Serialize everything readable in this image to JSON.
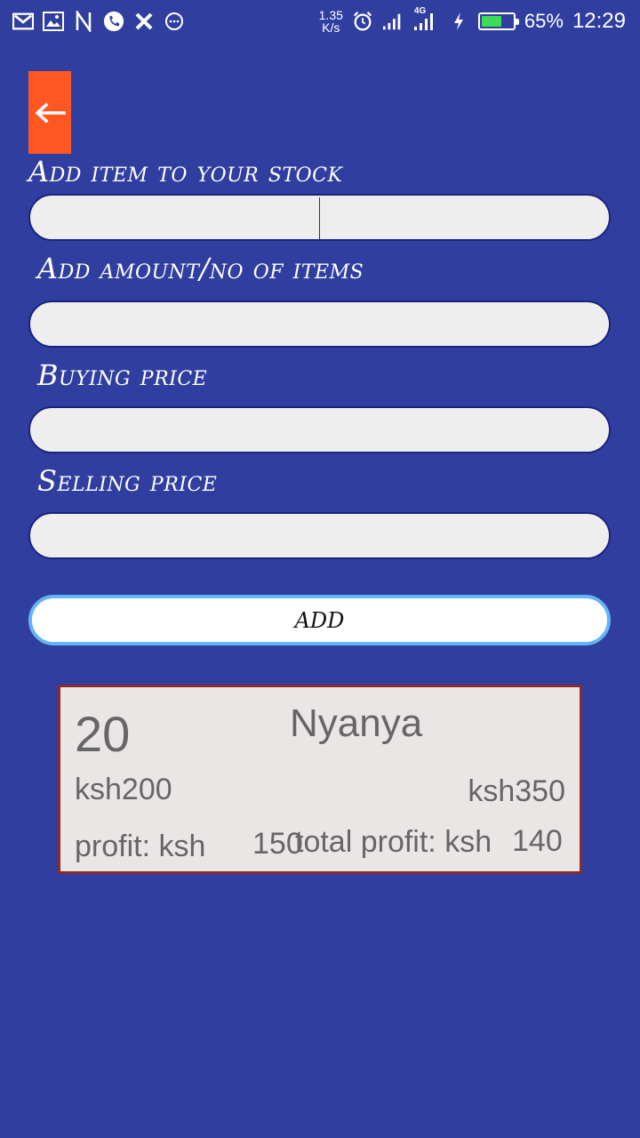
{
  "status_bar": {
    "notification_icons": [
      "gmail-icon",
      "image-icon",
      "n-icon",
      "phone-icon",
      "x-icon",
      "chat-icon"
    ],
    "net_speed_value": "1.35",
    "net_speed_unit": "K/s",
    "network_type": "4G",
    "battery_percent_text": "65%",
    "battery_level": 0.65,
    "battery_color": "#3ddc56",
    "time": "12:29"
  },
  "header": {
    "back_icon": "arrow-left-icon",
    "back_color": "#ff5722"
  },
  "form": {
    "item_label": "Add item to your stock",
    "item_value": "",
    "amount_label": "Add amount/no of items",
    "amount_value": "",
    "buying_label": "Buying price",
    "buying_value": "",
    "selling_label": "Selling price",
    "selling_value": "",
    "add_button": "ADD"
  },
  "stock_card": {
    "quantity": "20",
    "name": "Nyanya",
    "buying_price": "ksh200",
    "selling_price": "ksh350",
    "profit_label": "profit: ksh",
    "profit_value": "150",
    "total_profit_label": "total profit: ksh",
    "total_profit_value": "140"
  },
  "colors": {
    "background": "#303f9f",
    "field_bg": "#eeeeee",
    "card_bg": "#ebe6e6",
    "card_border": "#8b2a2a",
    "button_border": "#64b5f6"
  }
}
